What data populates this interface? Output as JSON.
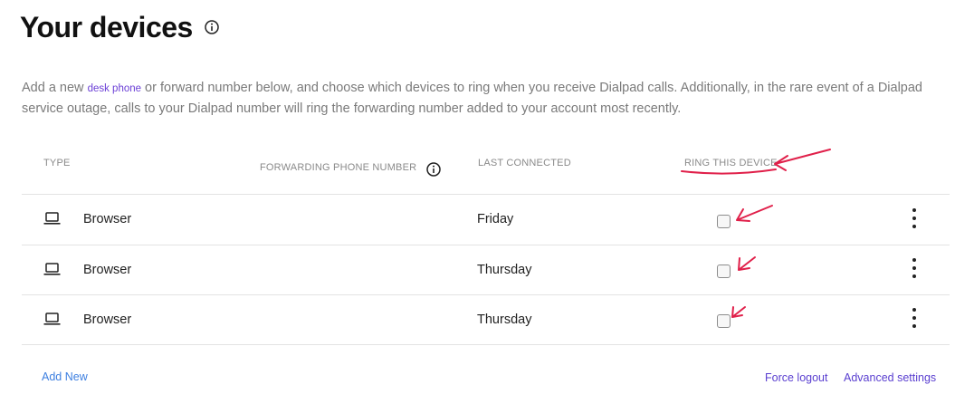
{
  "header": {
    "title": "Your devices",
    "info_icon": "info-icon"
  },
  "description": {
    "before_link": "Add a new ",
    "link": "desk phone",
    "after_link": " or forward number below, and choose which devices to ring when you receive Dialpad calls. Additionally, in the rare event of a Dialpad service outage, calls to your Dialpad number will ring the forwarding number added to your account most recently."
  },
  "table": {
    "columns": {
      "type": "TYPE",
      "forwarding": "FORWARDING PHONE NUMBER",
      "last_connected": "LAST CONNECTED",
      "ring": "RING THIS DEVICE"
    },
    "rows": [
      {
        "icon": "laptop-icon",
        "type": "Browser",
        "forwarding": "",
        "last_connected": "Friday",
        "ring": false
      },
      {
        "icon": "laptop-icon",
        "type": "Browser",
        "forwarding": "",
        "last_connected": "Thursday",
        "ring": false
      },
      {
        "icon": "laptop-icon",
        "type": "Browser",
        "forwarding": "",
        "last_connected": "Thursday",
        "ring": false
      }
    ]
  },
  "footer": {
    "add_new": "Add New",
    "force_logout": "Force logout",
    "advanced_settings": "Advanced settings"
  },
  "colors": {
    "link_purple": "#6b3fd6",
    "link_blue": "#3d7fe0",
    "annotation_red": "#e0204a"
  }
}
